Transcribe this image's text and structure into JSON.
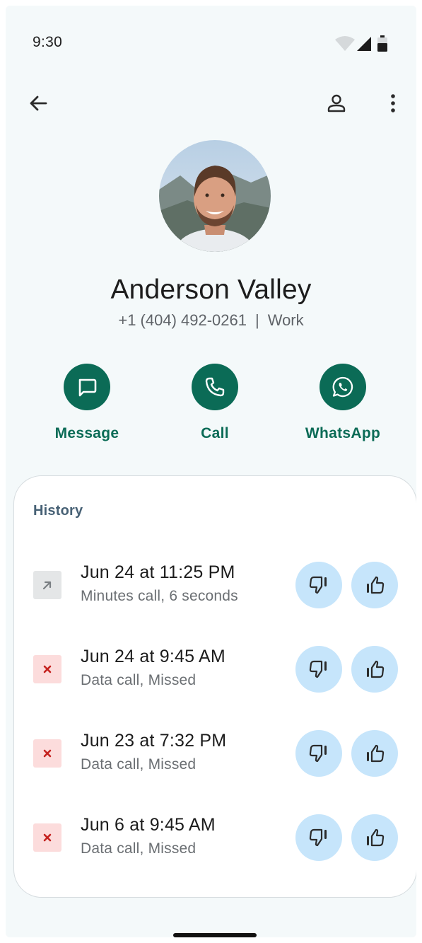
{
  "status_bar": {
    "time": "9:30"
  },
  "contact": {
    "name": "Anderson Valley",
    "phone": "+1 (404) 492-0261",
    "separator": "|",
    "label": "Work"
  },
  "actions": [
    {
      "label": "Message",
      "icon": "message-icon"
    },
    {
      "label": "Call",
      "icon": "phone-icon"
    },
    {
      "label": "WhatsApp",
      "icon": "whatsapp-icon"
    }
  ],
  "history": {
    "title": "History",
    "items": [
      {
        "title": "Jun 24 at 11:25 PM",
        "subtitle": "Minutes call, 6 seconds",
        "type": "outgoing",
        "icon": "outgoing-arrow-icon"
      },
      {
        "title": "Jun 24 at 9:45 AM",
        "subtitle": "Data call, Missed",
        "type": "missed",
        "icon": "missed-x-icon"
      },
      {
        "title": "Jun 23 at 7:32 PM",
        "subtitle": "Data call, Missed",
        "type": "missed",
        "icon": "missed-x-icon"
      },
      {
        "title": "Jun 6 at 9:45 AM",
        "subtitle": "Data call, Missed",
        "type": "missed",
        "icon": "missed-x-icon"
      }
    ]
  },
  "colors": {
    "background": "#f4f9fa",
    "accent": "#0b6b56",
    "feedback_button": "#c6e5fb",
    "missed_badge": "#fcdcdc",
    "missed_icon": "#c5221f",
    "history_title": "#476175"
  }
}
